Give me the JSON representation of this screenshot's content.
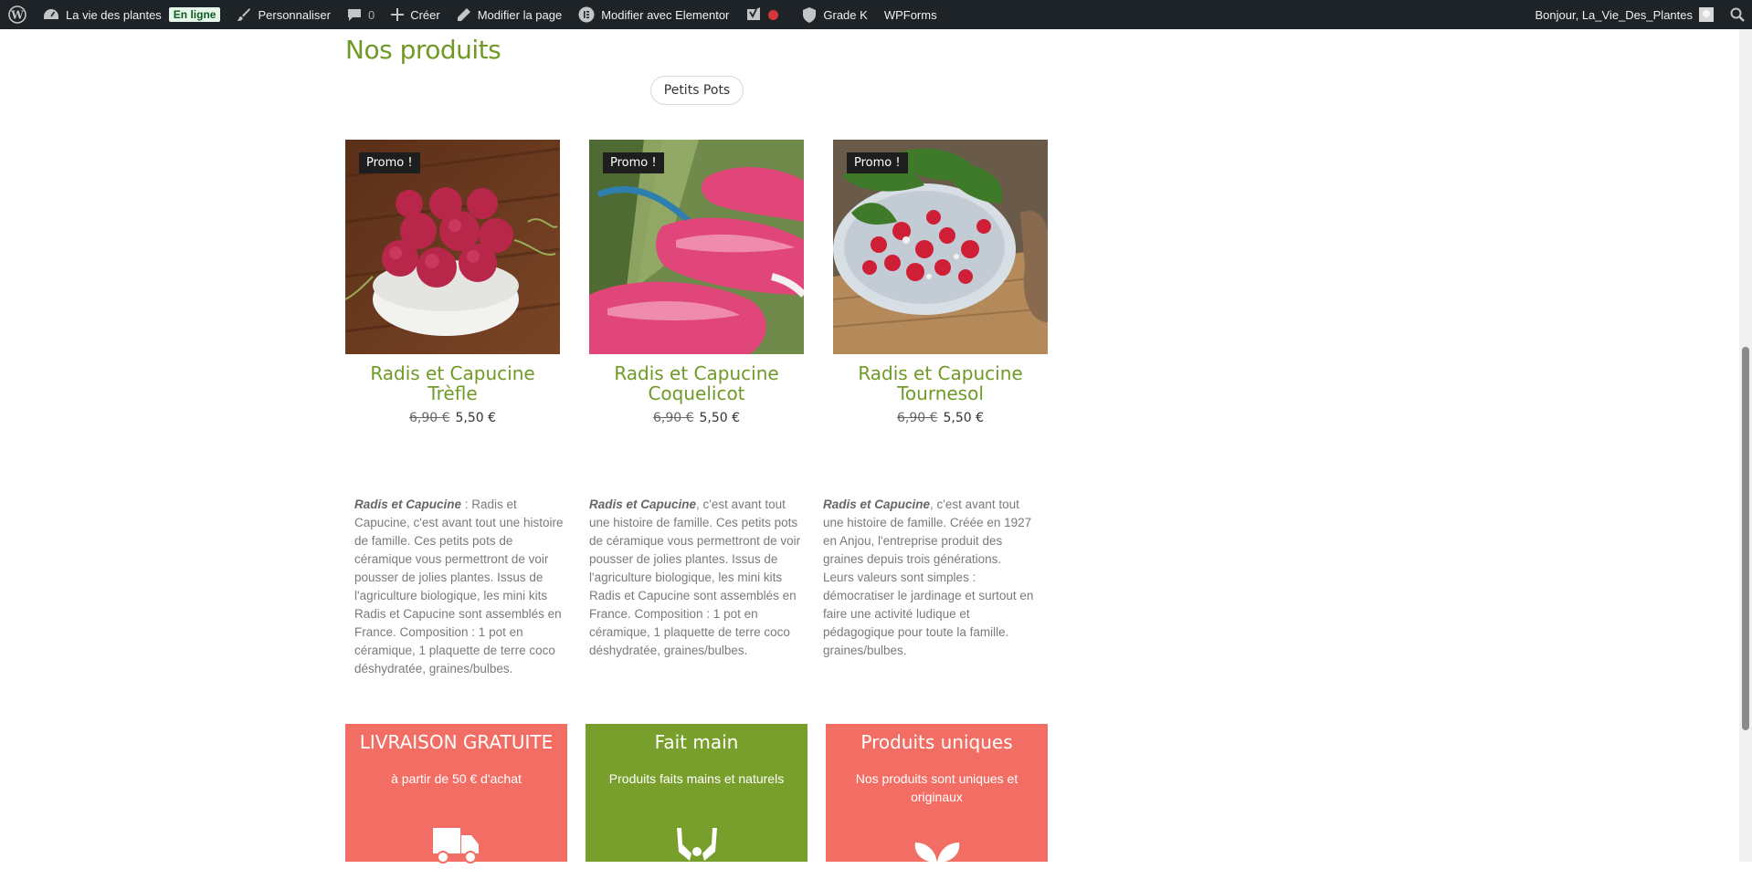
{
  "adminbar": {
    "site_name": "La vie des plantes",
    "status_badge": "En ligne",
    "customize": "Personnaliser",
    "comments_count": "0",
    "create": "Créer",
    "edit_page": "Modifier la page",
    "edit_elementor": "Modifier avec Elementor",
    "grade": "Grade K",
    "wpforms": "WPForms",
    "greeting": "Bonjour, La_Vie_Des_Plantes"
  },
  "section": {
    "title": "Nos produits",
    "filter_label": "Petits Pots"
  },
  "products": [
    {
      "badge": "Promo !",
      "name": "Radis et Capucine Trèfle",
      "old_price": "6,90 €",
      "price": "5,50 €"
    },
    {
      "badge": "Promo !",
      "name": "Radis et Capucine Coquelicot",
      "old_price": "6,90 €",
      "price": "5,50 €"
    },
    {
      "badge": "Promo !",
      "name": "Radis et Capucine Tournesol",
      "old_price": "6,90 €",
      "price": "5,50 €"
    }
  ],
  "descriptions": [
    {
      "brand": "Radis et Capucine",
      "text": " : Radis et Capucine, c'est avant tout une histoire de famille. Ces petits pots de céramique vous permettront de voir pousser de jolies plantes. Issus de l'agriculture biologique, les mini kits Radis et Capucine sont assemblés en France. Composition : 1 pot en céramique, 1 plaquette de terre coco déshydratée, graines/bulbes."
    },
    {
      "brand": "Radis et Capucine",
      "text": ", c'est avant tout une histoire de famille. Ces petits pots de céramique vous permettront de voir pousser de jolies plantes. Issus de l'agriculture biologique, les mini kits Radis et Capucine sont assemblés en France. Composition : 1 pot en céramique, 1 plaquette de terre coco déshydratée, graines/bulbes."
    },
    {
      "brand": "Radis et Capucine",
      "text": ", c'est avant tout une histoire de famille. Créée en 1927 en Anjou, l'entreprise produit des graines depuis trois générations. Leurs valeurs sont simples : démocratiser le jardinage et surtout en faire une activité ludique et pédagogique pour toute la famille. graines/bulbes."
    }
  ],
  "features": [
    {
      "title": "LIVRAISON GRATUITE",
      "subtitle": "à partir de 50 € d'achat",
      "color": "#f26d63",
      "icon": "truck-icon"
    },
    {
      "title": "Fait main",
      "subtitle": "Produits faits mains et naturels",
      "color": "#789e2c",
      "icon": "hands-icon"
    },
    {
      "title": "Produits uniques",
      "subtitle": "Nos produits sont uniques et originaux",
      "color": "#f26d63",
      "icon": "leaf-icon"
    }
  ],
  "colors": {
    "accent_green": "#6f9a25",
    "coral": "#f26d63",
    "adminbar_bg": "#1d2327"
  }
}
